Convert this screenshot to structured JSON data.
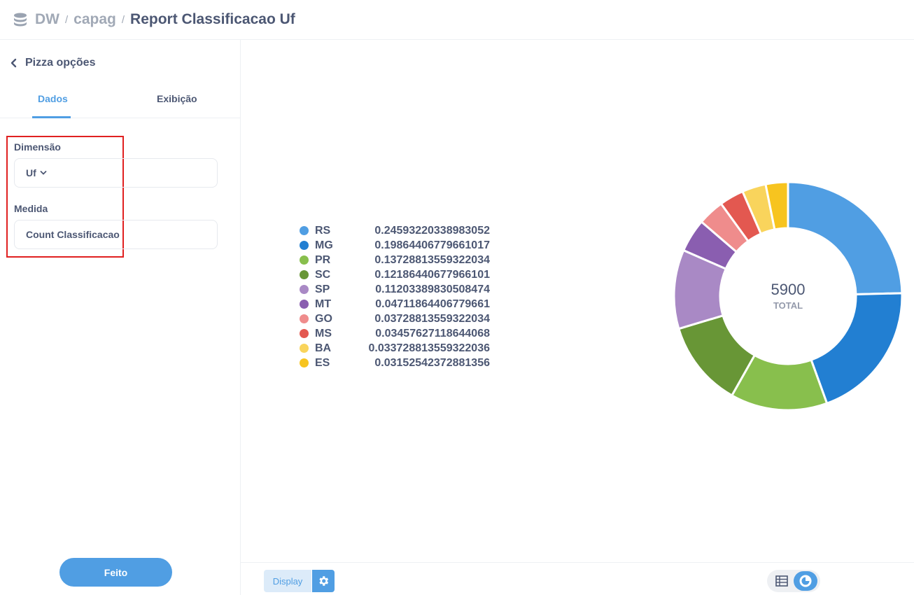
{
  "header": {
    "icon": "database-icon",
    "crumbs": [
      "DW",
      "capag"
    ],
    "separator": "/",
    "title": "Report Classificacao Uf"
  },
  "sidebar": {
    "back_label": "Pizza opções",
    "tabs": [
      {
        "label": "Dados",
        "active": true
      },
      {
        "label": "Exibição",
        "active": false
      }
    ],
    "dimension": {
      "label": "Dimensão",
      "value": "Uf"
    },
    "measure": {
      "label": "Medida",
      "value": "Count Classificacao"
    },
    "done_label": "Feito"
  },
  "chart_data": {
    "type": "pie",
    "style": "donut",
    "center_value": "5900",
    "center_label": "TOTAL",
    "legend_placement": "left",
    "slices": [
      {
        "name": "RS",
        "value": "0.24593220338983052",
        "color": "#509ee3"
      },
      {
        "name": "MG",
        "value": "0.19864406779661017",
        "color": "#227fd2"
      },
      {
        "name": "PR",
        "value": "0.13728813559322034",
        "color": "#88bf4d"
      },
      {
        "name": "SC",
        "value": "0.12186440677966101",
        "color": "#689636"
      },
      {
        "name": "SP",
        "value": "0.11203389830508474",
        "color": "#a989c5"
      },
      {
        "name": "MT",
        "value": "0.04711864406779661",
        "color": "#8a5eb0"
      },
      {
        "name": "GO",
        "value": "0.03728813559322034",
        "color": "#ef8c8c"
      },
      {
        "name": "MS",
        "value": "0.03457627118644068",
        "color": "#e35850"
      },
      {
        "name": "BA",
        "value": "0.033728813559322036",
        "color": "#f9d45c"
      },
      {
        "name": "ES",
        "value": "0.03152542372881356",
        "color": "#f7c41f"
      }
    ]
  },
  "footer": {
    "display_label": "Display",
    "settings_icon": "gear-icon",
    "table_icon": "table-icon",
    "chart_icon": "pie-chart-icon"
  }
}
